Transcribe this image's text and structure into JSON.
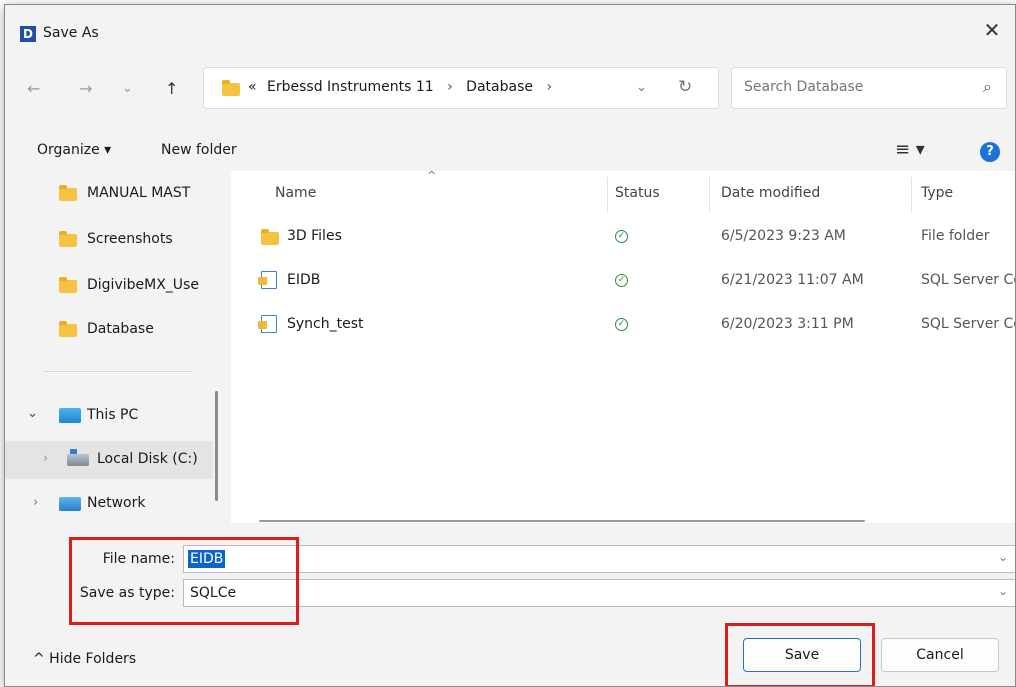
{
  "window": {
    "app_icon_letter": "D",
    "title": "Save As",
    "close_glyph": "✕"
  },
  "nav": {
    "back": "←",
    "forward": "→",
    "recent": "⌄",
    "up": "↑",
    "breadcrumb_prefix": "«",
    "crumbs": [
      "Erbessd Instruments 11",
      "Database"
    ],
    "crumb_sep": "›",
    "dropdown": "⌄",
    "refresh": "↻",
    "search_placeholder": "Search Database",
    "search_icon": "⌕"
  },
  "toolbar": {
    "organize": "Organize ▾",
    "new_folder": "New folder",
    "view": "≡ ▾",
    "help": "?"
  },
  "sidebar": {
    "quick": [
      "MANUAL MAST",
      "Screenshots",
      "DigivibeMX_Use",
      "Database"
    ],
    "this_pc": "This PC",
    "local_disk": "Local Disk (C:)",
    "network": "Network",
    "chevron_open": "⌄",
    "chevron_closed": "›"
  },
  "columns": {
    "name": "Name",
    "status": "Status",
    "date": "Date modified",
    "type": "Type",
    "sort_caret": "^"
  },
  "files": [
    {
      "name": "3D Files",
      "icon": "folder-icon",
      "status": "✓",
      "date": "6/5/2023 9:23 AM",
      "type": "File folder"
    },
    {
      "name": "EIDB",
      "icon": "database-file-icon",
      "status": "✓",
      "date": "6/21/2023 11:07 AM",
      "type": "SQL Server Co"
    },
    {
      "name": "Synch_test",
      "icon": "database-file-icon",
      "status": "✓",
      "date": "6/20/2023 3:11 PM",
      "type": "SQL Server Co"
    }
  ],
  "form": {
    "file_name_label": "File name:",
    "file_name_value": "EIDB",
    "save_type_label": "Save as type:",
    "save_type_value": "SQLCe",
    "dropdown": "⌄"
  },
  "footer": {
    "hide_folders": "^ Hide Folders",
    "save": "Save",
    "cancel": "Cancel"
  },
  "colors": {
    "accent": "#0b65c8",
    "highlight_box": "#e01b1b",
    "status_ok": "#2e8a3e"
  }
}
